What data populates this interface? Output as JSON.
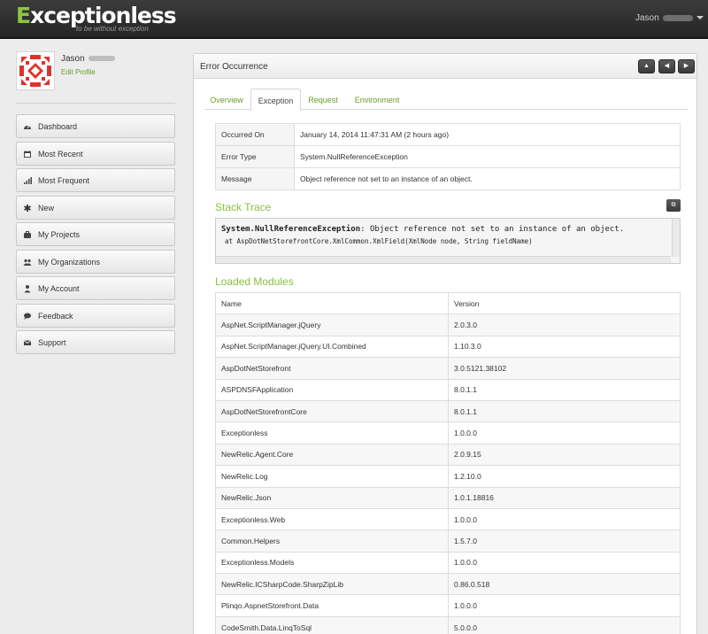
{
  "header": {
    "logo": "Exceptionless",
    "tagline": "to be without exception",
    "user": "Jason"
  },
  "profile": {
    "name": "Jason",
    "edit_link": "Edit Profile"
  },
  "nav": [
    {
      "label": "Dashboard",
      "icon": "dashboard-icon"
    },
    {
      "label": "Most Recent",
      "icon": "calendar-icon"
    },
    {
      "label": "Most Frequent",
      "icon": "signal-icon"
    },
    {
      "label": "New",
      "icon": "asterisk-icon"
    },
    {
      "label": "My Projects",
      "icon": "briefcase-icon"
    },
    {
      "label": "My Organizations",
      "icon": "group-icon"
    },
    {
      "label": "My Account",
      "icon": "user-icon"
    },
    {
      "label": "Feedback",
      "icon": "comment-icon"
    },
    {
      "label": "Support",
      "icon": "envelope-icon"
    }
  ],
  "panel": {
    "title": "Error Occurrence"
  },
  "tabs": [
    "Overview",
    "Exception",
    "Request",
    "Environment"
  ],
  "info": [
    {
      "key": "Occurred On",
      "value": "January 14, 2014 11:47:31 AM (2 hours ago)"
    },
    {
      "key": "Error Type",
      "value": "System.NullReferenceException"
    },
    {
      "key": "Message",
      "value": "Object reference not set to an instance of an object."
    }
  ],
  "stack": {
    "title": "Stack Trace",
    "type": "System.NullReferenceException",
    "message": ": Object reference not set to an instance of an object.",
    "frame": "at AspDotNetStorefrontCore.XmlCommon.XmlField(XmlNode node, String fieldName)"
  },
  "modules": {
    "title": "Loaded Modules",
    "columns": [
      "Name",
      "Version"
    ],
    "rows": [
      [
        "AspNet.ScriptManager.jQuery",
        "2.0.3.0"
      ],
      [
        "AspNet.ScriptManager.jQuery.UI.Combined",
        "1.10.3.0"
      ],
      [
        "AspDotNetStorefront",
        "3.0.5121.38102"
      ],
      [
        "ASPDNSFApplication",
        "8.0.1.1"
      ],
      [
        "AspDotNetStorefrontCore",
        "8.0.1.1"
      ],
      [
        "Exceptionless",
        "1.0.0.0"
      ],
      [
        "NewRelic.Agent.Core",
        "2.0.9.15"
      ],
      [
        "NewRelic.Log",
        "1.2.10.0"
      ],
      [
        "NewRelic.Json",
        "1.0.1.18816"
      ],
      [
        "Exceptionless.Web",
        "1.0.0.0"
      ],
      [
        "Common.Helpers",
        "1.5.7.0"
      ],
      [
        "Exceptionless.Models",
        "1.0.0.0"
      ],
      [
        "NewRelic.ICSharpCode.SharpZipLib",
        "0.86.0.518"
      ],
      [
        "Plinqo.AspnetStorefront.Data",
        "1.0.0.0"
      ],
      [
        "CodeSmith.Data.LinqToSql",
        "5.0.0.0"
      ]
    ]
  }
}
